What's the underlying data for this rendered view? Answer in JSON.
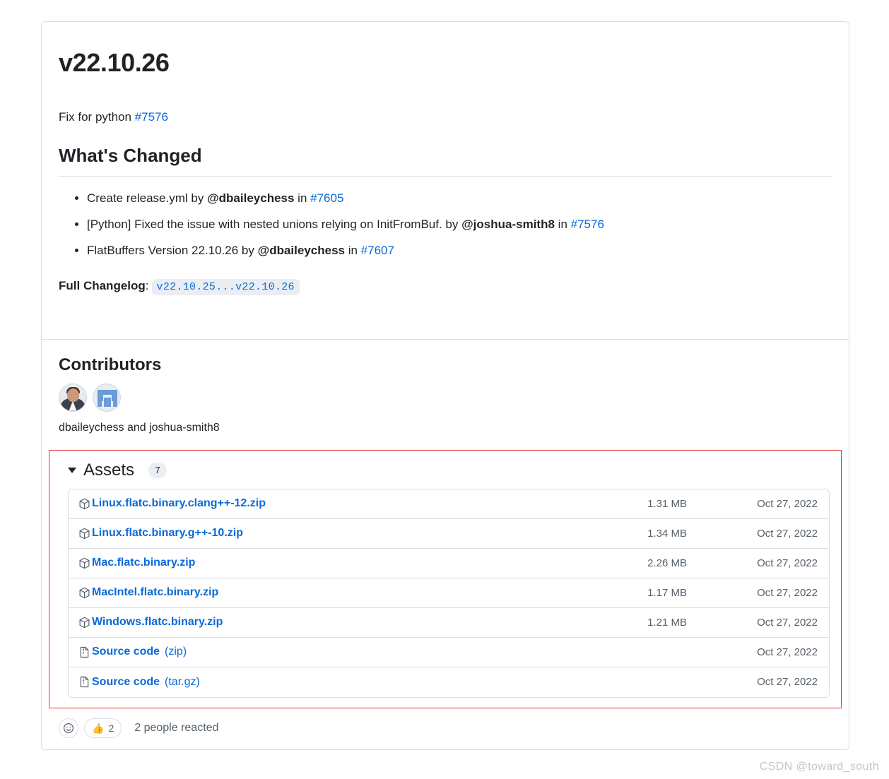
{
  "release": {
    "version_title": "v22.10.26",
    "intro_text": "Fix for python ",
    "intro_issue": "#7576",
    "whats_changed_heading": "What's Changed",
    "changes": [
      {
        "prefix": "Create release.yml by ",
        "user": "@dbaileychess",
        "mid": " in ",
        "pr": "#7605"
      },
      {
        "prefix": "[Python] Fixed the issue with nested unions relying on InitFromBuf. by ",
        "user": "@joshua-smith8",
        "mid": " in ",
        "pr": "#7576"
      },
      {
        "prefix": "FlatBuffers Version 22.10.26 by ",
        "user": "@dbaileychess",
        "mid": " in ",
        "pr": "#7607"
      }
    ],
    "full_changelog_label": "Full Changelog",
    "full_changelog_sep": ":",
    "full_changelog_range": "v22.10.25...v22.10.26"
  },
  "contributors": {
    "heading": "Contributors",
    "names": "dbaileychess and joshua-smith8",
    "avatars": [
      {
        "name": "dbaileychess",
        "kind": "photo"
      },
      {
        "name": "joshua-smith8",
        "kind": "identicon"
      }
    ]
  },
  "assets": {
    "title": "Assets",
    "count": "7",
    "caret_icon": "triangle-down-icon",
    "highlight_color": "#e3342f",
    "rows": [
      {
        "icon": "package-icon",
        "name": "Linux.flatc.binary.clang++-12.zip",
        "suffix": "",
        "size": "1.31 MB",
        "date": "Oct 27, 2022"
      },
      {
        "icon": "package-icon",
        "name": "Linux.flatc.binary.g++-10.zip",
        "suffix": "",
        "size": "1.34 MB",
        "date": "Oct 27, 2022"
      },
      {
        "icon": "package-icon",
        "name": "Mac.flatc.binary.zip",
        "suffix": "",
        "size": "2.26 MB",
        "date": "Oct 27, 2022"
      },
      {
        "icon": "package-icon",
        "name": "MacIntel.flatc.binary.zip",
        "suffix": "",
        "size": "1.17 MB",
        "date": "Oct 27, 2022"
      },
      {
        "icon": "package-icon",
        "name": "Windows.flatc.binary.zip",
        "suffix": "",
        "size": "1.21 MB",
        "date": "Oct 27, 2022"
      },
      {
        "icon": "file-zip-icon",
        "name": "Source code",
        "suffix": "(zip)",
        "size": "",
        "date": "Oct 27, 2022"
      },
      {
        "icon": "file-zip-icon",
        "name": "Source code",
        "suffix": "(tar.gz)",
        "size": "",
        "date": "Oct 27, 2022"
      }
    ]
  },
  "reactions": {
    "add_icon": "smiley-icon",
    "thumbsup_emoji": "👍",
    "thumbsup_count": "2",
    "summary": "2 people reacted"
  },
  "watermark": "CSDN @toward_south",
  "colors": {
    "link": "#0969da",
    "text": "#1f2328",
    "muted": "#57606a",
    "border": "#d8dee4",
    "code_bg": "#eaeef2",
    "highlight": "#e3342f"
  }
}
